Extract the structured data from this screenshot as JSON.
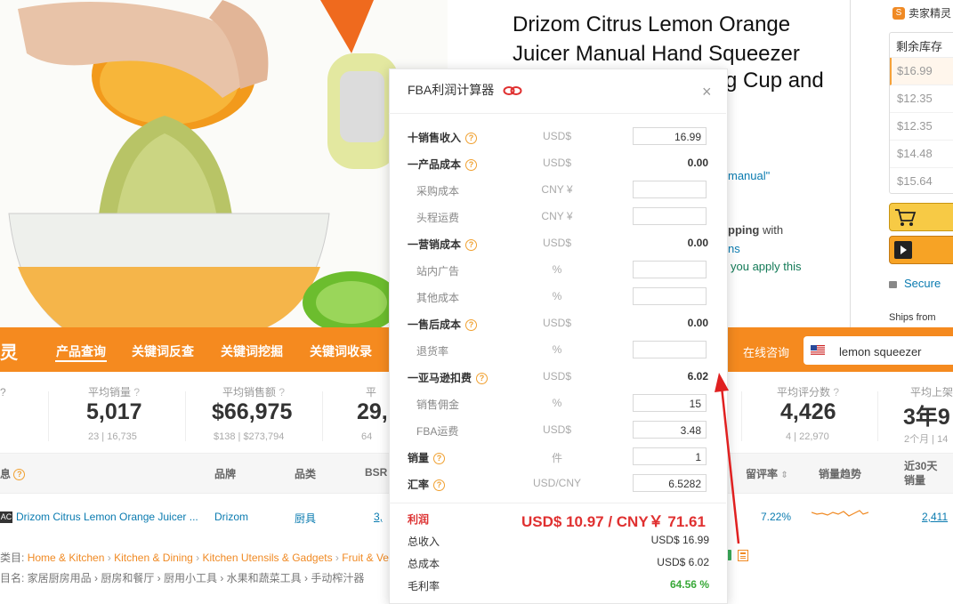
{
  "product": {
    "title": "Drizom Citrus Lemon Orange Juicer Manual Hand Squeezer",
    "title_line3_tail": "g Cup and",
    "frag_manual": "manual\"",
    "frag_shipping_bold": "pping",
    "frag_shipping_rest": " with",
    "frag_ns": "ns",
    "frag_apply": "you apply this"
  },
  "right_panel": {
    "seller_badge": "卖家精灵",
    "stock_header": "剩余库存",
    "prices": [
      "$16.99",
      "$12.35",
      "$12.35",
      "$14.48",
      "$15.64"
    ],
    "secure": "Secure",
    "ships_from": "Ships from"
  },
  "toolbar": {
    "logo": "灵",
    "items": [
      "产品查询",
      "关键词反查",
      "关键词挖掘",
      "关键词收录"
    ],
    "consult": "在线咨询",
    "search_value": "lemon squeezer"
  },
  "stats": [
    {
      "label": "平均销量",
      "value": "5,017",
      "sub": "23 | 16,735"
    },
    {
      "label": "平均销售额",
      "value": "$66,975",
      "sub": "$138 | $273,794"
    },
    {
      "label": "平",
      "value": "29,",
      "sub": "64"
    },
    {
      "label": "平均评分数",
      "value": "4,426",
      "sub": "4 | 22,970"
    },
    {
      "label": "平均上架",
      "value": "3年9",
      "sub": "2个月 | 14"
    }
  ],
  "table": {
    "headers": {
      "info": "息",
      "brand": "品牌",
      "category": "品类",
      "bsr": "BSR",
      "review_rate": "留评率",
      "sales_trend": "销量趋势",
      "sales30_l1": "近30天",
      "sales30_l2": "销量"
    },
    "row": {
      "badge": "AC",
      "name": "Drizom Citrus Lemon Orange Juicer ...",
      "brand": "Drizom",
      "category": "厨具",
      "bsr": "3,",
      "review_rate": "7.22%",
      "sales30": "2,411"
    },
    "breadcrumb_prefix": "类目:",
    "breadcrumb": [
      "Home & Kitchen",
      "Kitchen & Dining",
      "Kitchen Utensils & Gadgets",
      "Fruit & Ve"
    ],
    "breadcrumb_cn": "目名: 家居厨房用品 › 厨房和餐厅 › 厨用小工具 › 水果和蔬菜工具 › 手动榨汁器"
  },
  "fba": {
    "title": "FBA利润计算器",
    "rows": [
      {
        "label": "十销售收入",
        "unit": "USD$",
        "input": "16.99",
        "help": true,
        "kind": "bold"
      },
      {
        "label": "一产品成本",
        "unit": "USD$",
        "value": "0.00",
        "help": true,
        "kind": "bold"
      },
      {
        "label": "采购成本",
        "unit": "CNY ¥",
        "input": "",
        "kind": "sub"
      },
      {
        "label": "头程运费",
        "unit": "CNY ¥",
        "input": "",
        "kind": "sub"
      },
      {
        "label": "一营销成本",
        "unit": "USD$",
        "value": "0.00",
        "help": true,
        "kind": "bold"
      },
      {
        "label": "站内广告",
        "unit": "%",
        "input": "",
        "kind": "sub"
      },
      {
        "label": "其他成本",
        "unit": "%",
        "input": "",
        "kind": "sub"
      },
      {
        "label": "一售后成本",
        "unit": "USD$",
        "value": "0.00",
        "help": true,
        "kind": "bold"
      },
      {
        "label": "退货率",
        "unit": "%",
        "input": "",
        "kind": "sub"
      },
      {
        "label": "一亚马逊扣费",
        "unit": "USD$",
        "value": "6.02",
        "help": true,
        "kind": "bold"
      },
      {
        "label": "销售佣金",
        "unit": "%",
        "input": "15",
        "kind": "sub"
      },
      {
        "label": "FBA运费",
        "unit": "USD$",
        "input": "3.48",
        "kind": "sub"
      },
      {
        "label": "销量",
        "unit": "件",
        "input": "1",
        "help": true,
        "kind": "bold"
      },
      {
        "label": "汇率",
        "unit": "USD/CNY",
        "input": "6.5282",
        "help": true,
        "kind": "bold"
      }
    ],
    "profit_label": "利润",
    "profit_value": "USD$ 10.97 / CNY￥ 71.61",
    "summary": [
      {
        "label": "总收入",
        "value": "USD$ 16.99"
      },
      {
        "label": "总成本",
        "value": "USD$ 6.02"
      },
      {
        "label": "毛利率",
        "value": "64.56 %"
      }
    ],
    "help_glyph": "?"
  },
  "colors": {
    "accent": "#f58a1f",
    "profit": "#e03030",
    "arrow": "#e02020",
    "margin_green": "#38a838"
  }
}
